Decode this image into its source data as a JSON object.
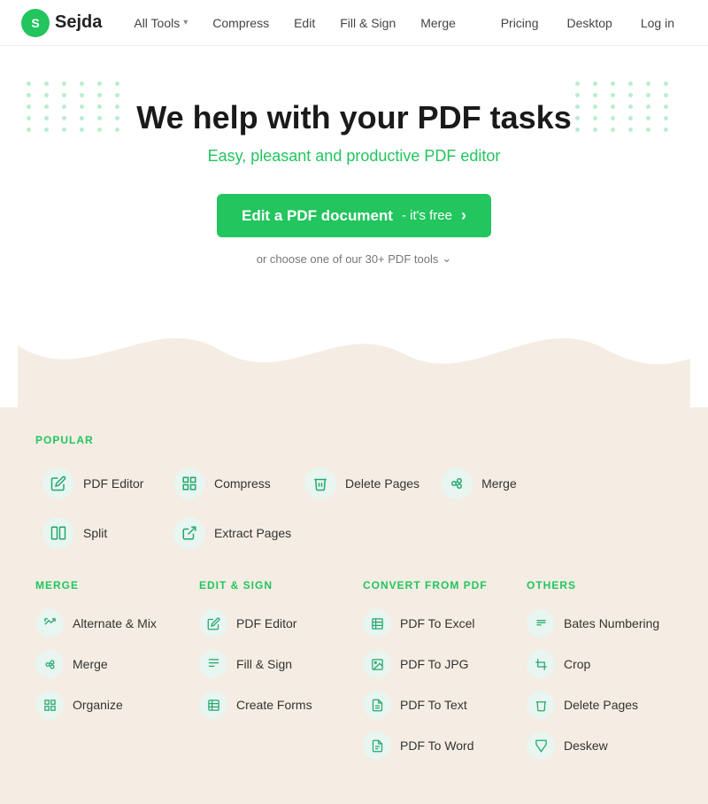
{
  "navbar": {
    "logo": "Sejda",
    "logo_letter": "S",
    "nav_items": [
      {
        "label": "All Tools",
        "has_chevron": true
      },
      {
        "label": "Compress",
        "has_chevron": false
      },
      {
        "label": "Edit",
        "has_chevron": false
      },
      {
        "label": "Fill & Sign",
        "has_chevron": false
      },
      {
        "label": "Merge",
        "has_chevron": false
      }
    ],
    "right_items": [
      {
        "label": "Pricing"
      },
      {
        "label": "Desktop"
      },
      {
        "label": "Log in"
      }
    ]
  },
  "hero": {
    "title": "We help with your PDF tasks",
    "subtitle": "Easy, pleasant and productive PDF editor",
    "cta_main": "Edit a PDF document",
    "cta_free": "- it's free",
    "tools_link": "or choose one of our 30+ PDF tools"
  },
  "popular_section": {
    "title": "POPULAR",
    "tools": [
      {
        "label": "PDF Editor",
        "icon": "✏️"
      },
      {
        "label": "Compress",
        "icon": "⬛"
      },
      {
        "label": "Delete Pages",
        "icon": "🗑"
      },
      {
        "label": "Merge",
        "icon": "⊞"
      },
      {
        "label": "Split",
        "icon": "⬜"
      },
      {
        "label": "Extract Pages",
        "icon": "↗"
      }
    ]
  },
  "categories": [
    {
      "title": "MERGE",
      "items": [
        {
          "label": "Alternate & Mix",
          "icon": "↕"
        },
        {
          "label": "Merge",
          "icon": "⊞"
        },
        {
          "label": "Organize",
          "icon": "⊟"
        }
      ]
    },
    {
      "title": "EDIT & SIGN",
      "items": [
        {
          "label": "PDF Editor",
          "icon": "✏️"
        },
        {
          "label": "Fill & Sign",
          "icon": "〰"
        },
        {
          "label": "Create Forms",
          "icon": "▦"
        }
      ]
    },
    {
      "title": "CONVERT FROM PDF",
      "items": [
        {
          "label": "PDF To Excel",
          "icon": "📊"
        },
        {
          "label": "PDF To JPG",
          "icon": "🖼"
        },
        {
          "label": "PDF To Text",
          "icon": "📄"
        },
        {
          "label": "PDF To Word",
          "icon": "📝"
        }
      ]
    },
    {
      "title": "OTHERS",
      "items": [
        {
          "label": "Bates Numbering",
          "icon": "#"
        },
        {
          "label": "Crop",
          "icon": "✂"
        },
        {
          "label": "Delete Pages",
          "icon": "🗑"
        },
        {
          "label": "Deskew",
          "icon": "⟲"
        }
      ]
    }
  ]
}
